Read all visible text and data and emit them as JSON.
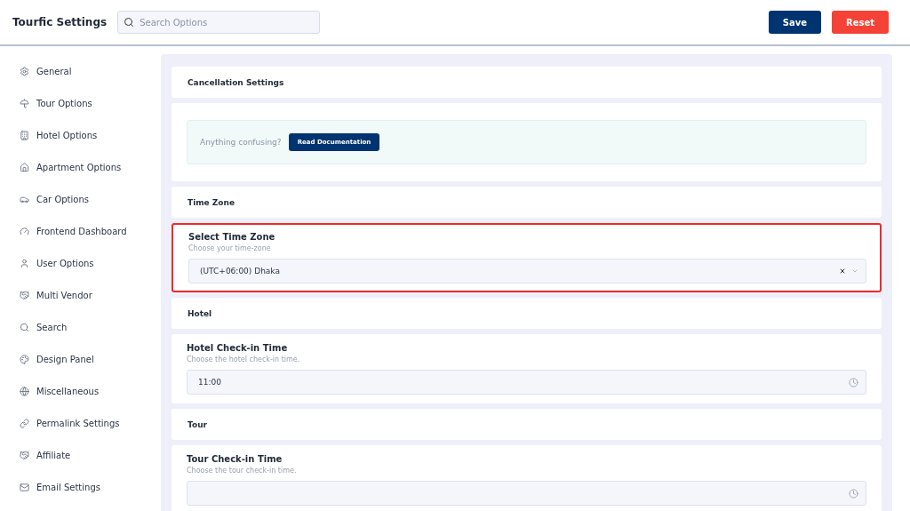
{
  "header": {
    "title": "Tourfic Settings",
    "search": {
      "placeholder": "Search Options"
    },
    "buttons": [
      {
        "label": "Save",
        "kind": "primary"
      },
      {
        "label": "Reset",
        "kind": "danger"
      }
    ]
  },
  "sidebar": {
    "items": [
      {
        "label": "General"
      },
      {
        "label": "Tour Options"
      },
      {
        "label": "Hotel Options"
      },
      {
        "label": "Apartment Options"
      },
      {
        "label": "Car Options"
      },
      {
        "label": "Frontend Dashboard"
      },
      {
        "label": "User Options"
      },
      {
        "label": "Multi Vendor"
      },
      {
        "label": "Search"
      },
      {
        "label": "Design Panel"
      },
      {
        "label": "Miscellaneous"
      },
      {
        "label": "Permalink Settings"
      },
      {
        "label": "Affiliate"
      },
      {
        "label": "Email Settings"
      }
    ]
  },
  "sections": [
    {
      "kind": "heading",
      "title": "Cancellation Settings"
    },
    {
      "kind": "notice",
      "text": "Anything confusing?",
      "button": "Read Documentation"
    },
    {
      "kind": "heading",
      "title": "Time Zone"
    },
    {
      "kind": "select",
      "title": "Select Time Zone",
      "description": "Choose your time-zone",
      "value": "(UTC+06:00) Dhaka",
      "highlighted": true
    },
    {
      "kind": "heading",
      "title": "Hotel"
    },
    {
      "kind": "time",
      "title": "Hotel Check-in Time",
      "description": "Choose the hotel check-in time.",
      "value": "11:00",
      "highlighted": false
    },
    {
      "kind": "heading",
      "title": "Tour"
    },
    {
      "kind": "time",
      "title": "Tour Check-in Time",
      "description": "Choose the tour check-in time.",
      "highlighted": false
    }
  ]
}
